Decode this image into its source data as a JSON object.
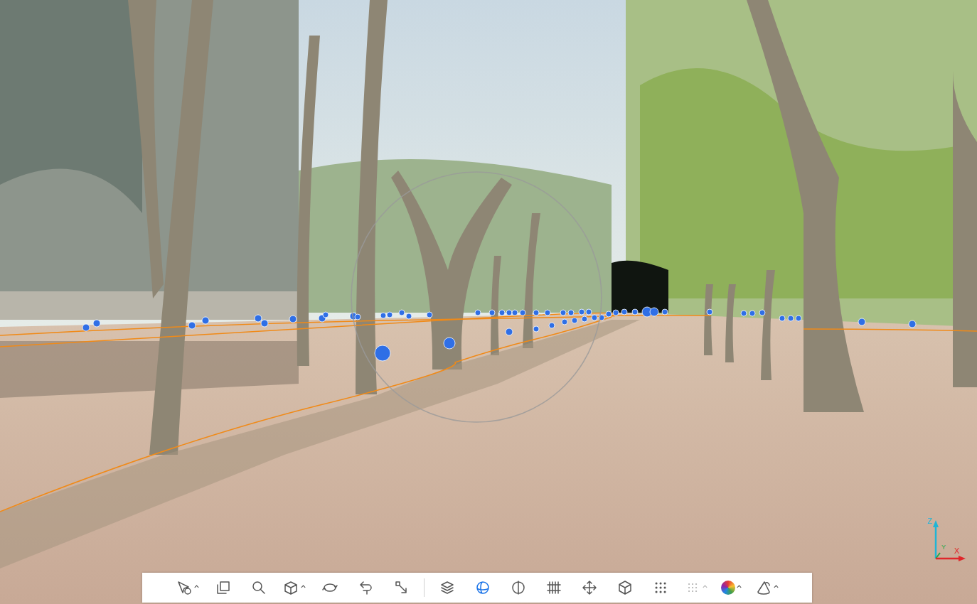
{
  "viewer": {
    "axes": [
      {
        "label": "Z",
        "color": "#1fb5d6"
      },
      {
        "label": "Y",
        "color": "#2aa84a"
      },
      {
        "label": "X",
        "color": "#e0262a"
      }
    ]
  },
  "toolbar": {
    "groups": [
      [
        {
          "menu": true,
          "selected": false,
          "disabled": false
        },
        {
          "menu": false,
          "selected": false,
          "disabled": false
        },
        {
          "menu": false,
          "selected": false,
          "disabled": false
        },
        {
          "menu": true,
          "selected": false,
          "disabled": false
        },
        {
          "menu": false,
          "selected": false,
          "disabled": false
        },
        {
          "menu": false,
          "selected": false,
          "disabled": false
        },
        {
          "menu": false,
          "selected": false,
          "disabled": false
        }
      ],
      [
        {
          "menu": false,
          "selected": false,
          "disabled": false
        },
        {
          "menu": false,
          "selected": true,
          "disabled": false
        },
        {
          "menu": false,
          "selected": false,
          "disabled": false
        },
        {
          "menu": false,
          "selected": false,
          "disabled": false
        },
        {
          "menu": false,
          "selected": false,
          "disabled": false
        },
        {
          "menu": false,
          "selected": false,
          "disabled": false
        },
        {
          "menu": false,
          "selected": false,
          "disabled": false
        },
        {
          "menu": true,
          "selected": false,
          "disabled": true
        },
        {
          "menu": true,
          "selected": false,
          "disabled": false
        },
        {
          "menu": true,
          "selected": false,
          "disabled": false
        }
      ]
    ]
  }
}
